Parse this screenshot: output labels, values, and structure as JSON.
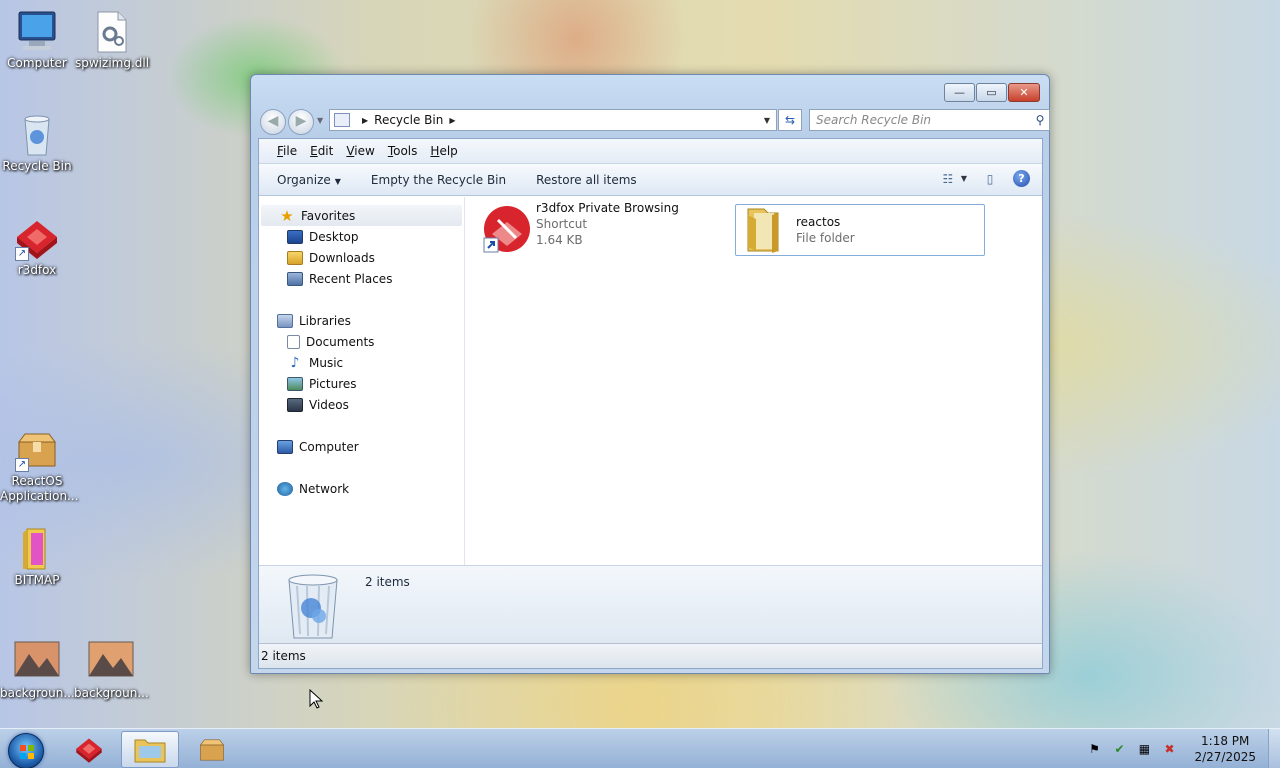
{
  "desktop": {
    "icons": [
      {
        "label": "Computer"
      },
      {
        "label": "spwizimg.dll"
      },
      {
        "label": "Recycle Bin"
      },
      {
        "label": "r3dfox"
      },
      {
        "label": "ReactOS Application..."
      },
      {
        "label": "BITMAP"
      },
      {
        "label": "backgroun..."
      },
      {
        "label": "backgroun..."
      }
    ]
  },
  "window": {
    "title_buttons": {
      "minimize": "—",
      "maximize": "▭",
      "close": "✕"
    },
    "address": {
      "crumbs": [
        "Recycle Bin"
      ]
    },
    "search": {
      "placeholder": "Search Recycle Bin"
    },
    "menu": [
      {
        "label": "File",
        "accel": "F",
        "rest": "ile"
      },
      {
        "label": "Edit",
        "accel": "E",
        "rest": "dit"
      },
      {
        "label": "View",
        "accel": "V",
        "rest": "iew"
      },
      {
        "label": "Tools",
        "accel": "T",
        "rest": "ools"
      },
      {
        "label": "Help",
        "accel": "H",
        "rest": "elp"
      }
    ],
    "commands": {
      "organize": "Organize",
      "empty": "Empty the Recycle Bin",
      "restore": "Restore all items"
    },
    "navigation": {
      "favorites": "Favorites",
      "desktop": "Desktop",
      "downloads": "Downloads",
      "recent": "Recent Places",
      "libraries": "Libraries",
      "documents": "Documents",
      "music": "Music",
      "pictures": "Pictures",
      "videos": "Videos",
      "computer": "Computer",
      "network": "Network"
    },
    "items": [
      {
        "name": "r3dfox Private Browsing",
        "type": "Shortcut",
        "size": "1.64 KB"
      },
      {
        "name": "reactos",
        "type": "File folder"
      }
    ],
    "details": {
      "count": "2 items"
    },
    "status": {
      "text": "2 items"
    }
  },
  "taskbar": {
    "clock_time": "1:18 PM",
    "clock_date": "2/27/2025"
  },
  "colors": {
    "accent": "#1b5ba8",
    "close_red": "#c8402c",
    "folder_yellow": "#e8c45a",
    "r3dfox_red": "#d8242c"
  }
}
